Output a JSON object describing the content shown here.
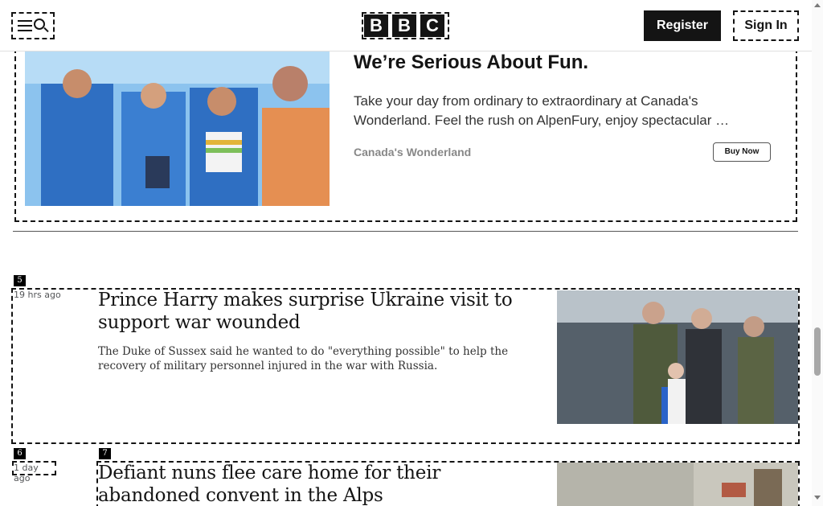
{
  "header": {
    "logo_letters": [
      "B",
      "B",
      "C"
    ],
    "register_label": "Register",
    "signin_label": "Sign In"
  },
  "ad": {
    "title": "We’re Serious About Fun.",
    "body": "Take your day from ordinary to extraordinary at Canada's Wonderland. Feel the rush on AlpenFury, enjoy spectacular …",
    "source": "Canada's Wonderland",
    "cta": "Buy Now"
  },
  "articles": [
    {
      "time": "19 hrs ago",
      "headline": "Prince Harry makes surprise Ukraine visit to support war wounded",
      "summary": "The Duke of Sussex said he wanted to do \"everything possible\" to help the recovery of military personnel injured in the war with Russia."
    },
    {
      "time": "1 day ago",
      "headline": "Defiant nuns flee care home for their abandoned convent in the Alps",
      "summary": ""
    }
  ],
  "markers": [
    "1",
    "2",
    "3",
    "4",
    "5",
    "6",
    "7"
  ],
  "icons": {
    "menu": "menu-icon",
    "search": "search-icon"
  }
}
